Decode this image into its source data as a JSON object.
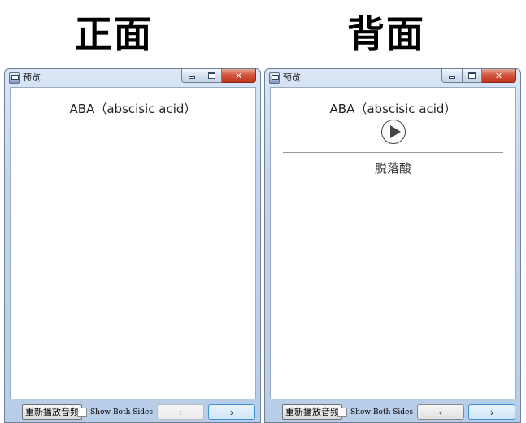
{
  "side_labels": {
    "front": "正面",
    "back": "背面"
  },
  "windows": [
    {
      "title": "预览",
      "term": "ABA（abscisic acid）",
      "show_audio_button": false,
      "answer": "",
      "replay_label": "重新播放音频",
      "show_both_label": "Show Both Sides",
      "show_both_checked": false,
      "prev_label": "‹",
      "next_label": "›",
      "prev_enabled": false,
      "next_focused": true
    },
    {
      "title": "预览",
      "term": "ABA（abscisic acid）",
      "show_audio_button": true,
      "answer": "脱落酸",
      "replay_label": "重新播放音频",
      "show_both_label": "Show Both Sides",
      "show_both_checked": false,
      "prev_label": "‹",
      "next_label": "›",
      "prev_enabled": true,
      "next_focused": true
    }
  ],
  "icons": {
    "window": "app-window-icon",
    "minimize": "minimize-icon",
    "maximize": "maximize-icon",
    "close": "close-icon",
    "play": "play-icon"
  },
  "colors": {
    "close_button": "#c9432a",
    "window_frame": "#c4d6ee",
    "focus": "#3c8fd6"
  }
}
